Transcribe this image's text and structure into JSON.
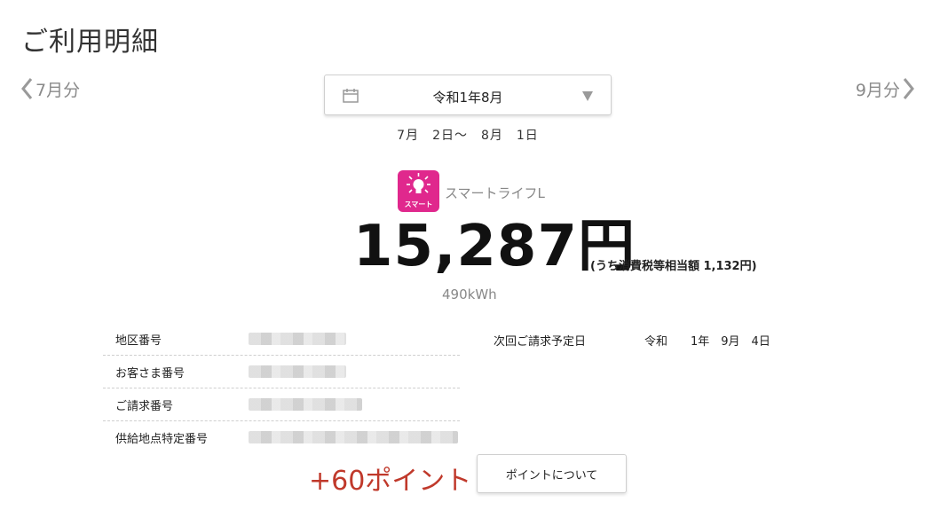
{
  "page": {
    "title": "ご利用明細"
  },
  "nav": {
    "prev_label": "7月分",
    "next_label": "9月分"
  },
  "month_select": {
    "selected": "令和1年8月"
  },
  "period": "7月　2日〜　8月　1日",
  "plan": {
    "icon_label": "スマート",
    "name": "スマートライフL",
    "icon_color": "#e0288d"
  },
  "billing": {
    "amount": "15,287円",
    "tax_note": "(うち消費税等相当額 1,132円)",
    "usage": "490kWh"
  },
  "info": [
    {
      "label": "地区番号",
      "value": ""
    },
    {
      "label": "お客さま番号",
      "value": ""
    },
    {
      "label": "ご請求番号",
      "value": ""
    },
    {
      "label": "供給地点特定番号",
      "value": ""
    }
  ],
  "next_billing": {
    "label": "次回ご請求予定日",
    "value": "令和　　1年　9月　4日"
  },
  "points": {
    "earned": "+60ポイント",
    "button_label": "ポイントについて",
    "color": "#c0392b"
  }
}
